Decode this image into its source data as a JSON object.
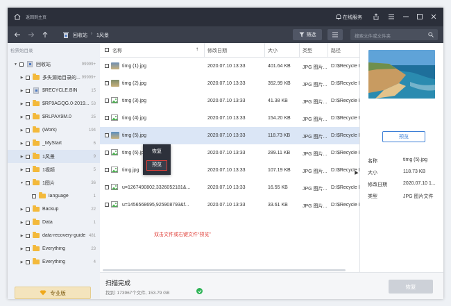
{
  "titlebar": {
    "home_label": "返回到主页",
    "service_label": "在线服务"
  },
  "navbar": {
    "breadcrumb": [
      "回收站",
      "1风景"
    ],
    "filter_label": "筛选",
    "search_placeholder": "搜索文件或文件夹"
  },
  "sidebar": {
    "header": "检票始目录",
    "items": [
      {
        "name": "回收站",
        "count": "99999+",
        "indent": 0,
        "expanded": true,
        "icon": "recycle"
      },
      {
        "name": "多失源始目录的...",
        "count": "99999+",
        "indent": 1,
        "expanded": false,
        "icon": "folder"
      },
      {
        "name": "$RECYCLE.BIN",
        "count": "15",
        "indent": 1,
        "expanded": false,
        "icon": "recycle"
      },
      {
        "name": "$RF9AGQG.0-2019...",
        "count": "53",
        "indent": 1,
        "expanded": false,
        "icon": "folder"
      },
      {
        "name": "$RLPAX9M.0",
        "count": "25",
        "indent": 1,
        "expanded": false,
        "icon": "folder"
      },
      {
        "name": "(Work)",
        "count": "194",
        "indent": 1,
        "expanded": false,
        "icon": "folder"
      },
      {
        "name": "_MyStart",
        "count": "6",
        "indent": 1,
        "expanded": false,
        "icon": "folder"
      },
      {
        "name": "1风景",
        "count": "9",
        "indent": 1,
        "expanded": false,
        "icon": "folder",
        "selected": true
      },
      {
        "name": "1视频",
        "count": "5",
        "indent": 1,
        "expanded": false,
        "icon": "folder"
      },
      {
        "name": "1图片",
        "count": "36",
        "indent": 1,
        "expanded": true,
        "icon": "folder"
      },
      {
        "name": "language",
        "count": "1",
        "indent": 2,
        "expanded": false,
        "icon": "folder"
      },
      {
        "name": "Backup",
        "count": "22",
        "indent": 1,
        "expanded": false,
        "icon": "folder"
      },
      {
        "name": "Data",
        "count": "1",
        "indent": 1,
        "expanded": false,
        "icon": "folder"
      },
      {
        "name": "data-recovery-guide",
        "count": "481",
        "indent": 1,
        "expanded": false,
        "icon": "folder"
      },
      {
        "name": "Everything",
        "count": "23",
        "indent": 1,
        "expanded": false,
        "icon": "folder"
      },
      {
        "name": "Everything",
        "count": "4",
        "indent": 1,
        "expanded": false,
        "icon": "folder"
      }
    ],
    "pro_label": "专业版"
  },
  "table": {
    "headers": {
      "name": "名称",
      "date": "修改日期",
      "size": "大小",
      "type": "类型",
      "path": "路径"
    },
    "rows": [
      {
        "name": "timg (1).jpg",
        "date": "2020.07.10 13:33",
        "size": "401.64 KB",
        "type": "JPG 图片...",
        "path": "D:\\$Recycle B",
        "thumb": "#6e8fb5"
      },
      {
        "name": "timg (2).jpg",
        "date": "2020.07.10 13:33",
        "size": "352.99 KB",
        "type": "JPG 图片...",
        "path": "D:\\$Recycle B",
        "thumb": "#7f8c6a"
      },
      {
        "name": "timg (3).jpg",
        "date": "2020.07.10 13:33",
        "size": "41.38 KB",
        "type": "JPG 图片...",
        "path": "D:\\$Recycle B",
        "thumb": "generic"
      },
      {
        "name": "timg (4).jpg",
        "date": "2020.07.10 13:33",
        "size": "154.20 KB",
        "type": "JPG 图片...",
        "path": "D:\\$Recycle B",
        "thumb": "generic"
      },
      {
        "name": "timg (5).jpg",
        "date": "2020.07.10 13:33",
        "size": "118.73 KB",
        "type": "JPG 图片...",
        "path": "D:\\$Recycle B",
        "thumb": "#5a8fc2",
        "selected": true
      },
      {
        "name": "timg (6).jpg",
        "date": "2020.07.10 13:33",
        "size": "289.11 KB",
        "type": "JPG 图片...",
        "path": "D:\\$Recycle B",
        "thumb": "generic"
      },
      {
        "name": "timg.jpg",
        "date": "2020.07.10 13:33",
        "size": "107.19 KB",
        "type": "JPG 图片...",
        "path": "D:\\$Recycle B",
        "thumb": "generic"
      },
      {
        "name": "u=1267490802,3326052181&...",
        "date": "2020.07.10 13:33",
        "size": "16.55 KB",
        "type": "JPG 图片...",
        "path": "D:\\$Recycle B",
        "thumb": "generic"
      },
      {
        "name": "u=1456568695,925908793&f...",
        "date": "2020.07.10 13:33",
        "size": "33.61 KB",
        "type": "JPG 图片...",
        "path": "D:\\$Recycle B",
        "thumb": "generic"
      }
    ],
    "hint": "双击文件或右键文件“预览”"
  },
  "context_menu": {
    "items": [
      "恢复",
      "预览"
    ]
  },
  "preview": {
    "button": "预览",
    "details": [
      {
        "label": "名称",
        "value": "timg (5).jpg"
      },
      {
        "label": "大小",
        "value": "118.73 KB"
      },
      {
        "label": "修改日期",
        "value": "2020.07.10 1..."
      },
      {
        "label": "类型",
        "value": "JPG 图片文件"
      }
    ]
  },
  "status": {
    "title": "扫描完成",
    "detail": "找到: 173967个文件, 153.79 GB",
    "recover_label": "恢复"
  }
}
